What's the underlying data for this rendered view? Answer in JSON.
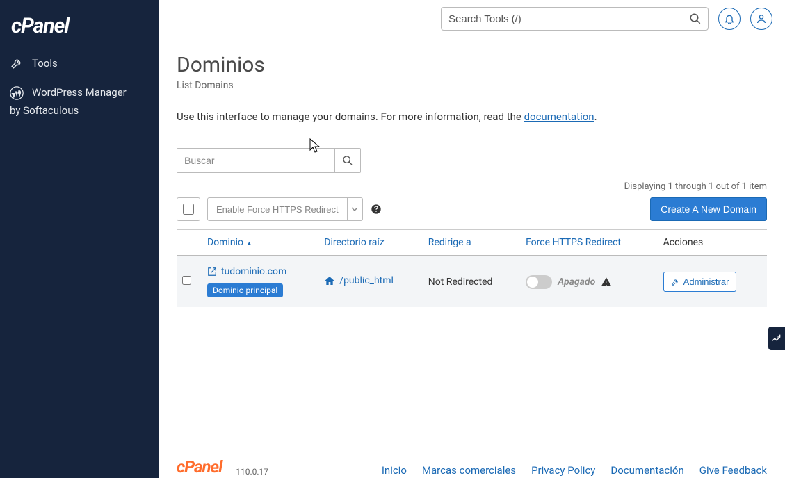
{
  "brand": "cPanel",
  "sidebar": {
    "items": [
      {
        "label": "Tools",
        "icon": "tools-icon"
      },
      {
        "label_line1": "WordPress Manager",
        "label_line2": "by Softaculous",
        "icon": "wordpress-icon"
      }
    ]
  },
  "topbar": {
    "search_placeholder": "Search Tools (/)"
  },
  "page": {
    "title": "Dominios",
    "subtitle": "List Domains",
    "intro_prefix": "Use this interface to manage your domains. For more information, read the ",
    "intro_link": "documentation",
    "intro_suffix": ".",
    "filter_placeholder": "Buscar",
    "count_text": "Displaying 1 through 1 out of 1 item",
    "bulk_action_label": "Enable Force HTTPS Redirect",
    "create_button": "Create A New Domain",
    "columns": {
      "domain": "Dominio",
      "root": "Directorio raíz",
      "redirect": "Redirige a",
      "https": "Force HTTPS Redirect",
      "actions": "Acciones"
    },
    "rows": [
      {
        "domain": "tudominio.com",
        "badge": "Dominio principal",
        "root": "/public_html",
        "redirect": "Not Redirected",
        "https_state": "Apagado",
        "manage": "Administrar"
      }
    ]
  },
  "footer": {
    "brand": "cPanel",
    "version": "110.0.17",
    "links": [
      "Inicio",
      "Marcas comerciales",
      "Privacy Policy",
      "Documentación",
      "Give Feedback"
    ]
  }
}
